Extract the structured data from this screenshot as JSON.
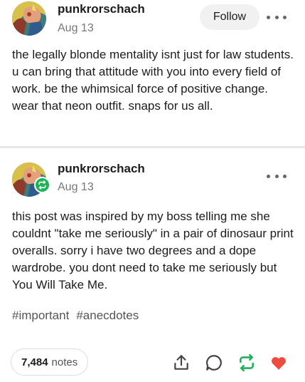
{
  "post1": {
    "username": "punkrorschach",
    "date": "Aug 13",
    "follow_label": "Follow",
    "body": "the legally blonde mentality isnt just for law students. u can bring that attitude with you into every field of work. be the whimsical force of positive change. wear that neon outfit. snaps for us all."
  },
  "post2": {
    "username": "punkrorschach",
    "date": "Aug 13",
    "body": "this post was inspired by my boss telling me she couldnt \"take me seriously\" in a pair of dinosaur print overalls. sorry i have two degrees and a dope wardrobe. you dont need to take me seriously but You Will Take Me.",
    "tags": [
      "#important",
      "#anecdotes"
    ],
    "notes_count": "7,484",
    "notes_label": "notes"
  },
  "colors": {
    "reblog_green": "#21b159",
    "like_red": "#ef4b3f",
    "follow_bg": "#f1f1f1"
  },
  "icons": [
    "share-icon",
    "reply-icon",
    "reblog-icon",
    "heart-icon",
    "more-icon"
  ]
}
